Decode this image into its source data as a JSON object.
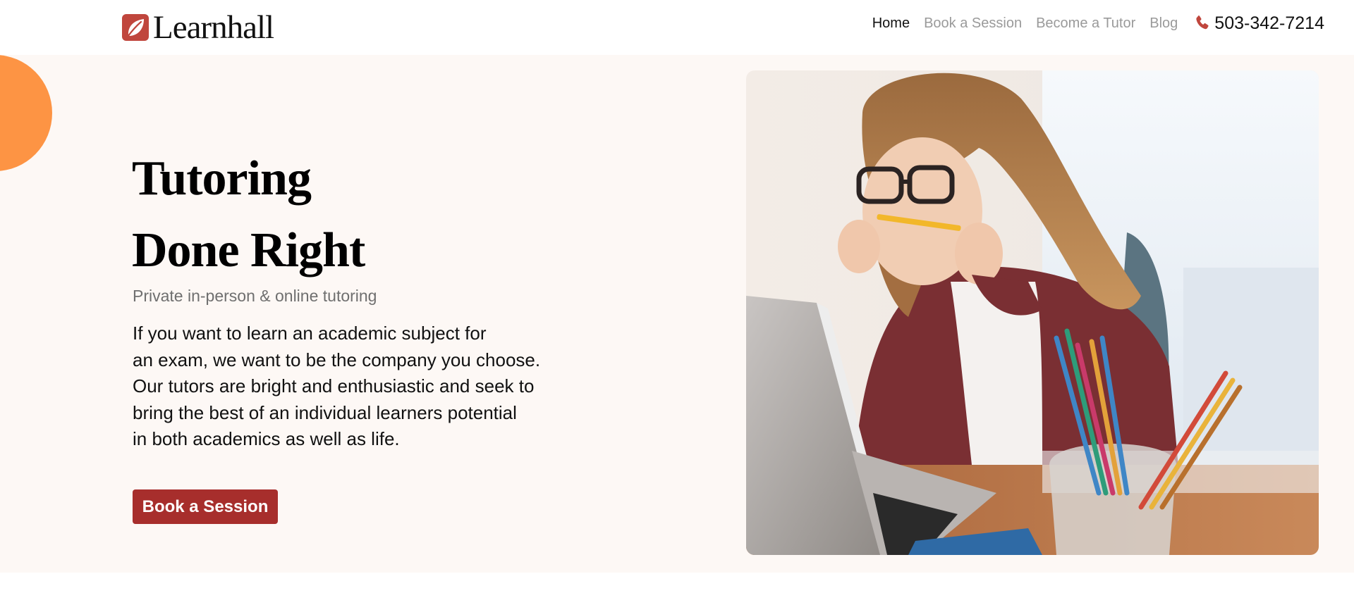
{
  "brand": {
    "name": "Learnhall",
    "logo_icon": "leaf-icon",
    "accent_color": "#c0463d"
  },
  "nav": {
    "items": [
      {
        "label": "Home",
        "active": true
      },
      {
        "label": "Book a Session",
        "active": false
      },
      {
        "label": "Become a Tutor",
        "active": false
      },
      {
        "label": "Blog",
        "active": false
      }
    ],
    "phone": {
      "icon": "phone-icon",
      "number": "503-342-7214"
    }
  },
  "hero": {
    "title_lines": [
      "Tutoring",
      "Done Right"
    ],
    "subtitle": "Private in-person & online tutoring",
    "body_lines": [
      "If you want to learn an academic subject for",
      "an exam, we want to be the company you choose.",
      "Our tutors are bright and enthusiastic and seek to",
      "bring the best of an individual learners potential",
      "in both academics as well as life."
    ],
    "cta_label": "Book a Session",
    "cta_color": "#a72e2c",
    "background_color": "#fdf8f5",
    "blob_color": "#fd9444",
    "photo": "student-with-laptop-photo"
  }
}
